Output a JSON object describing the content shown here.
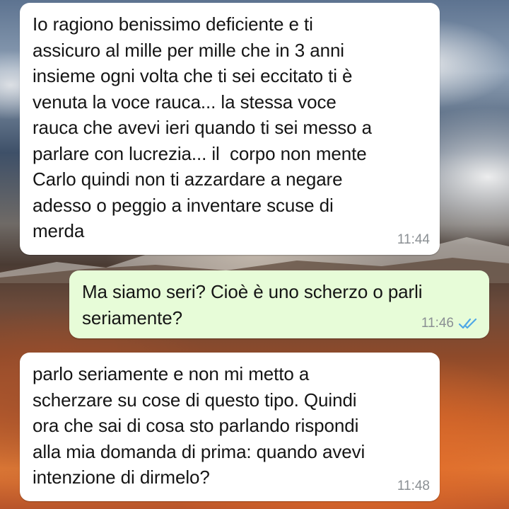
{
  "messages": [
    {
      "direction": "incoming",
      "text": "Io ragiono benissimo deficiente e ti\nassicuro al mille per mille che in 3 anni\ninsieme ogni volta che ti sei eccitato ti è\nvenuta la voce rauca... la stessa voce\nrauca che avevi ieri quando ti sei messo a\nparlare con lucrezia... il  corpo non mente\nCarlo quindi non ti azzardare a negare\nadesso o peggio a inventare scuse di\nmerda",
      "time": "11:44"
    },
    {
      "direction": "outgoing",
      "text": "Ma siamo seri? Cioè è uno scherzo o parli\nseriamente?",
      "time": "11:46",
      "status_icon": "read-double-check-icon",
      "status_color": "#4fa8e6"
    },
    {
      "direction": "incoming",
      "text": "parlo seriamente e non mi metto a\nscherzare su cose di questo tipo. Quindi\nora che sai di cosa sto parlando rispondi\nalla mia domanda di prima: quando avevi\nintenzione di dirmelo?",
      "time": "11:48"
    }
  ],
  "colors": {
    "incoming_bubble": "#ffffff",
    "outgoing_bubble": "#e7fcd8",
    "message_text": "#151515",
    "timestamp": "#8a8f93"
  }
}
